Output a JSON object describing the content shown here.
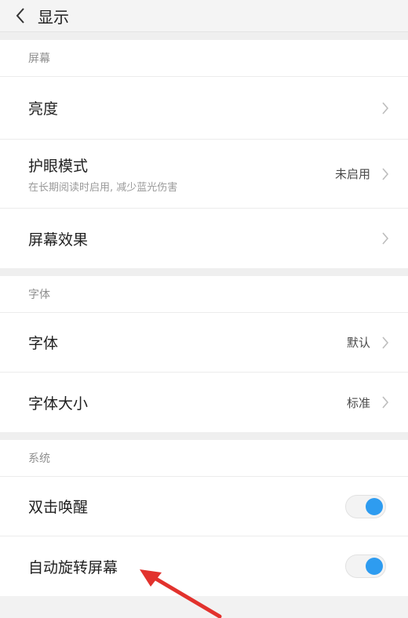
{
  "header": {
    "title": "显示",
    "back_icon": "chevron-left-icon"
  },
  "sections": [
    {
      "title": "屏幕",
      "items": [
        {
          "label": "亮度"
        },
        {
          "label": "护眼模式",
          "subtitle": "在长期阅读时启用, 减少蓝光伤害",
          "value": "未启用"
        },
        {
          "label": "屏幕效果"
        }
      ]
    },
    {
      "title": "字体",
      "items": [
        {
          "label": "字体",
          "value": "默认"
        },
        {
          "label": "字体大小",
          "value": "标准"
        }
      ]
    },
    {
      "title": "系统",
      "items": [
        {
          "label": "双击唤醒",
          "toggle": true
        },
        {
          "label": "自动旋转屏幕",
          "toggle": true
        }
      ]
    }
  ],
  "colors": {
    "toggle_on": "#2e9cf0",
    "annotation_arrow": "#e2322d",
    "background": "#f2f2f2"
  }
}
